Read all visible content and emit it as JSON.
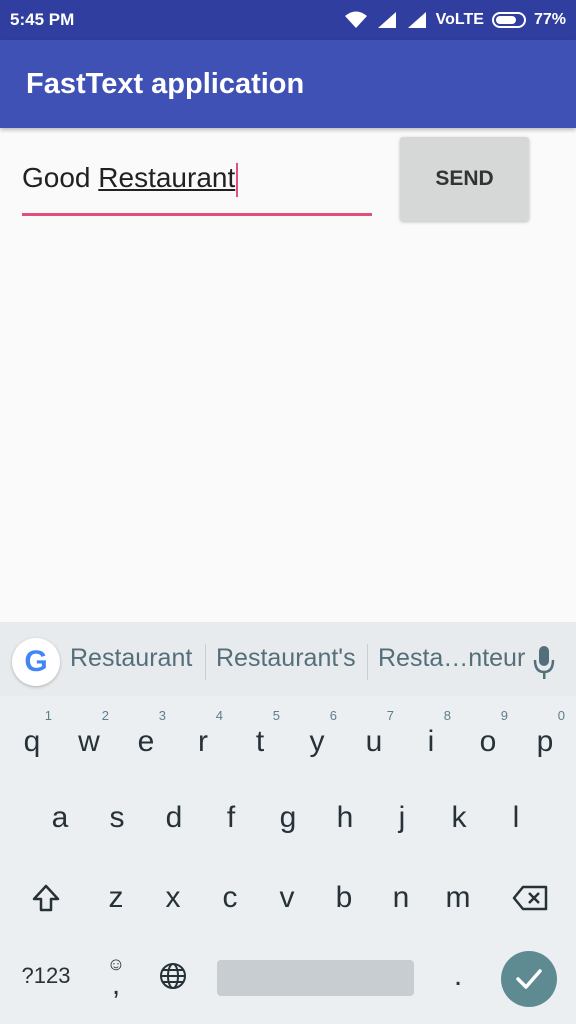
{
  "status": {
    "time": "5:45 PM",
    "network": "VoLTE",
    "battery": "77%",
    "battery_level": 0.77
  },
  "app": {
    "title": "FastText application"
  },
  "input": {
    "word1": "Good ",
    "word2": "Restaurant"
  },
  "send_button": {
    "label": "SEND"
  },
  "keyboard": {
    "suggestions": [
      "Restaurant",
      "Restaurant's",
      "Resta…nteur"
    ],
    "row1": [
      {
        "k": "q",
        "h": "1"
      },
      {
        "k": "w",
        "h": "2"
      },
      {
        "k": "e",
        "h": "3"
      },
      {
        "k": "r",
        "h": "4"
      },
      {
        "k": "t",
        "h": "5"
      },
      {
        "k": "y",
        "h": "6"
      },
      {
        "k": "u",
        "h": "7"
      },
      {
        "k": "i",
        "h": "8"
      },
      {
        "k": "o",
        "h": "9"
      },
      {
        "k": "p",
        "h": "0"
      }
    ],
    "row2": [
      "a",
      "s",
      "d",
      "f",
      "g",
      "h",
      "j",
      "k",
      "l"
    ],
    "row3": [
      "z",
      "x",
      "c",
      "v",
      "b",
      "n",
      "m"
    ],
    "symbols_label": "?123",
    "comma": ",",
    "period": "."
  }
}
